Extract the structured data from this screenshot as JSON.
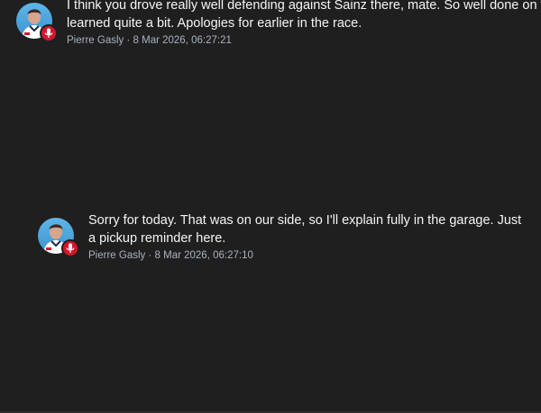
{
  "messages": [
    {
      "text": "I think you drove really well defending against Sainz there, mate. So well done on that,\nlearned quite a bit. Apologies for earlier in the race.",
      "author": "Pierre Gasly",
      "separator": "·",
      "timestamp": "8 Mar 2026, 06:27:21",
      "avatar_icon": "driver-avatar",
      "badge_icon": "microphone-icon"
    },
    {
      "text": "Sorry for today. That was on our side, so I'll explain fully in the garage. Just\na pickup reminder here.",
      "author": "Pierre Gasly",
      "separator": "·",
      "timestamp": "8 Mar 2026, 06:27:10",
      "avatar_icon": "driver-avatar",
      "badge_icon": "microphone-icon"
    }
  ],
  "colors": {
    "background": "#1f1f1f",
    "text": "#f5f5f5",
    "meta": "#a9b2bd",
    "badge": "#d8142c",
    "avatar_bg": "#4aa5de"
  }
}
